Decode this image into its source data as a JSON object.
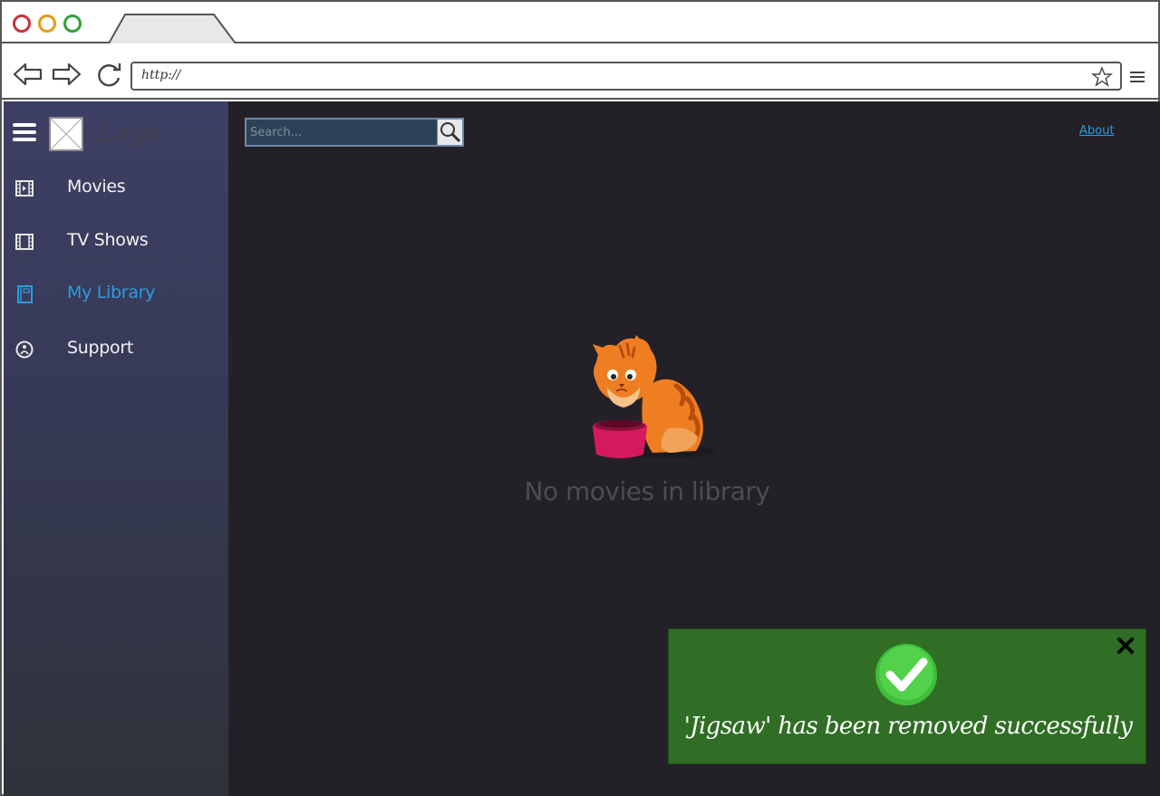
{
  "browser": {
    "address": "http://"
  },
  "sidebar": {
    "logo_text": "Logo",
    "items": [
      {
        "label": "Movies",
        "icon": "film-icon"
      },
      {
        "label": "TV Shows",
        "icon": "filmstrip-icon"
      },
      {
        "label": "My Library",
        "icon": "book-icon",
        "active": true
      },
      {
        "label": "Support",
        "icon": "support-icon"
      }
    ]
  },
  "header": {
    "search_placeholder": "Search...",
    "about_label": "About"
  },
  "main": {
    "empty_message": "No movies in library",
    "illustration": "cat-with-empty-bowl"
  },
  "toast": {
    "message": "'Jigsaw' has been removed successfully",
    "status": "success"
  },
  "colors": {
    "accent": "#2a9ce0",
    "toast_bg": "#2f6e24",
    "main_bg": "#232127"
  }
}
